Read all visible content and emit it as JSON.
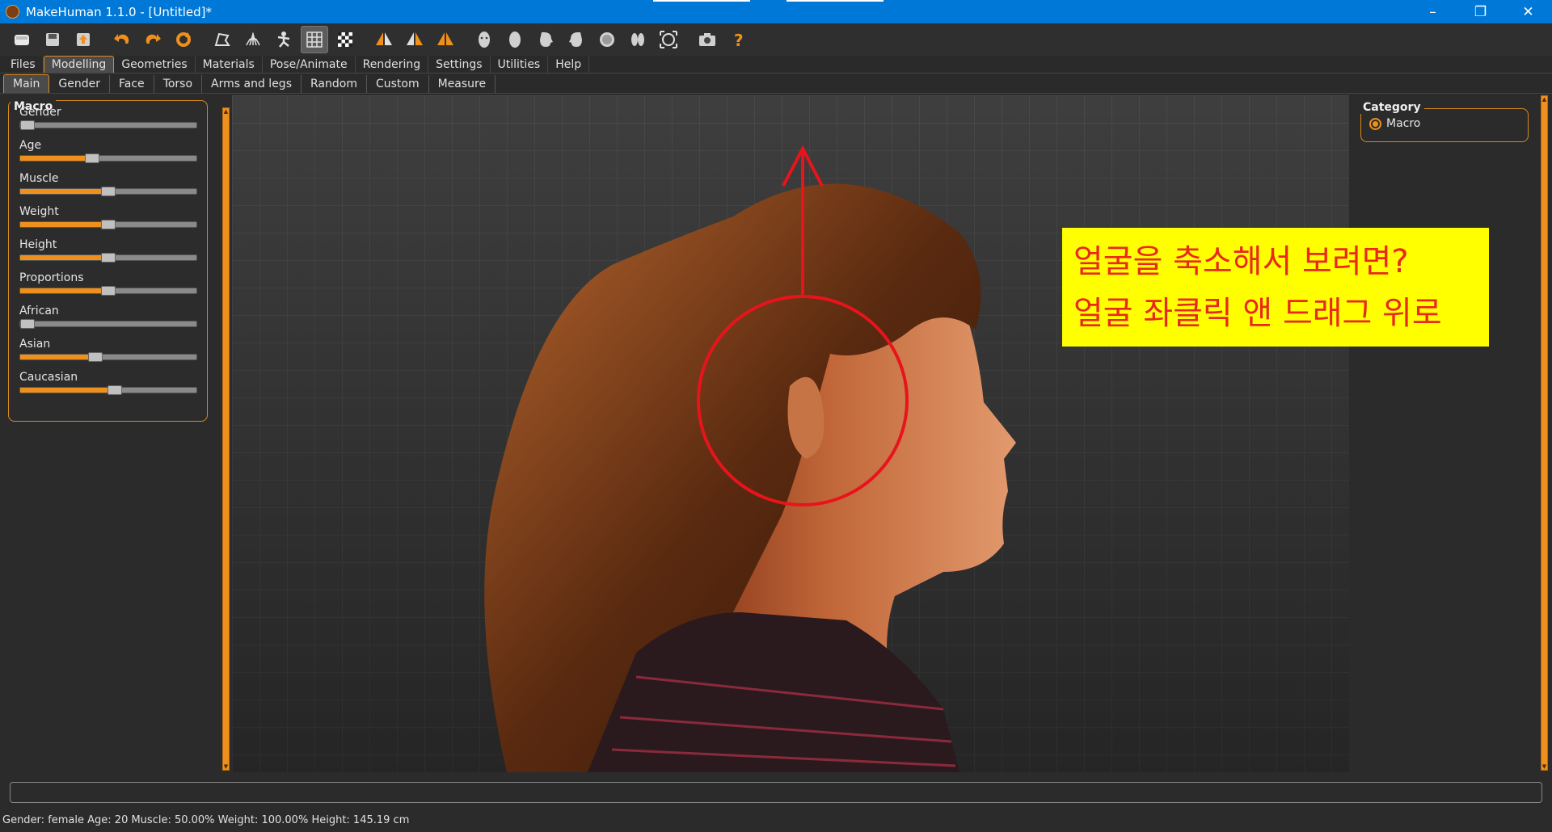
{
  "window": {
    "title": "MakeHuman 1.1.0 - [Untitled]*",
    "controls": [
      "–",
      "❐",
      "✕"
    ]
  },
  "toolbar": {
    "buttons": [
      {
        "name": "new-icon"
      },
      {
        "name": "save-icon"
      },
      {
        "name": "export-icon"
      },
      {
        "name": "undo-icon"
      },
      {
        "name": "redo-icon"
      },
      {
        "name": "reset-icon"
      },
      {
        "name": "smooth-icon"
      },
      {
        "name": "wireframe-icon"
      },
      {
        "name": "pose-icon"
      },
      {
        "name": "grid-icon"
      },
      {
        "name": "checker-icon"
      },
      {
        "name": "symmetry-right-icon"
      },
      {
        "name": "symmetry-left-icon"
      },
      {
        "name": "symmetry-icon"
      },
      {
        "name": "front-view-icon"
      },
      {
        "name": "back-view-icon"
      },
      {
        "name": "left-view-icon"
      },
      {
        "name": "right-view-icon"
      },
      {
        "name": "top-view-icon"
      },
      {
        "name": "bottom-view-icon"
      },
      {
        "name": "reset-camera-icon"
      },
      {
        "name": "screenshot-icon"
      },
      {
        "name": "help-icon"
      }
    ]
  },
  "menu": {
    "tabs": [
      "Files",
      "Modelling",
      "Geometries",
      "Materials",
      "Pose/Animate",
      "Rendering",
      "Settings",
      "Utilities",
      "Help"
    ],
    "active": "Modelling"
  },
  "subtabs": {
    "tabs": [
      "Main",
      "Gender",
      "Face",
      "Torso",
      "Arms and legs",
      "Random",
      "Custom",
      "Measure"
    ],
    "active": "Main"
  },
  "macro_panel": {
    "title": "Macro",
    "sliders": [
      {
        "label": "Gender",
        "value": 0.0
      },
      {
        "label": "Age",
        "value": 0.4
      },
      {
        "label": "Muscle",
        "value": 0.5
      },
      {
        "label": "Weight",
        "value": 0.5
      },
      {
        "label": "Height",
        "value": 0.5
      },
      {
        "label": "Proportions",
        "value": 0.5
      },
      {
        "label": "African",
        "value": 0.0
      },
      {
        "label": "Asian",
        "value": 0.42
      },
      {
        "label": "Caucasian",
        "value": 0.54
      }
    ]
  },
  "annotation": {
    "line1": "얼굴을 축소해서 보려면?",
    "line2": "얼굴 좌클릭 앤 드래그 위로",
    "text_color": "#e8291c",
    "background": "#ffff00"
  },
  "category_panel": {
    "title": "Category",
    "option": "Macro"
  },
  "status": {
    "text": "Gender: female Age: 20 Muscle: 50.00% Weight: 100.00% Height: 145.19 cm"
  },
  "colors": {
    "accent": "#f0901c",
    "titlebar": "#0078d7"
  }
}
